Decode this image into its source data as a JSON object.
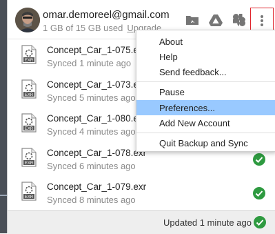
{
  "account": {
    "email": "omar.demoreel@gmail.com",
    "quota": "1 GB of 15 GB used",
    "upgrade_label": "Upgrade"
  },
  "header_icons": [
    "drive-folder-icon",
    "google-drive-icon",
    "google-photos-icon",
    "more-options-icon"
  ],
  "files": [
    {
      "name": "Concept_Car_1-075.exr",
      "status": "Synced 1 minute ago",
      "icon": "exr-file-icon"
    },
    {
      "name": "Concept_Car_1-073.exr",
      "status": "Synced 5 minutes ago",
      "icon": "exr-file-icon"
    },
    {
      "name": "Concept_Car_1-080.exr",
      "status": "Synced 4 minutes ago",
      "icon": "exr-file-icon"
    },
    {
      "name": "Concept_Car_1-078.exr",
      "status": "Synced 6 minutes ago",
      "icon": "exr-file-icon"
    },
    {
      "name": "Concept_Car_1-079.exr",
      "status": "Synced 8 minutes ago",
      "icon": "exr-file-icon"
    }
  ],
  "file_icon_label": "EXR",
  "footer": {
    "status": "Updated 1 minute ago"
  },
  "menu": {
    "items": [
      "About",
      "Help",
      "Send feedback...",
      "Pause",
      "Preferences...",
      "Add New Account",
      "Quit Backup and Sync"
    ],
    "highlighted": "Preferences..."
  },
  "colors": {
    "check_green": "#2e9a40",
    "highlight": "#99c9ff",
    "more_button_outline": "#e0242c"
  }
}
